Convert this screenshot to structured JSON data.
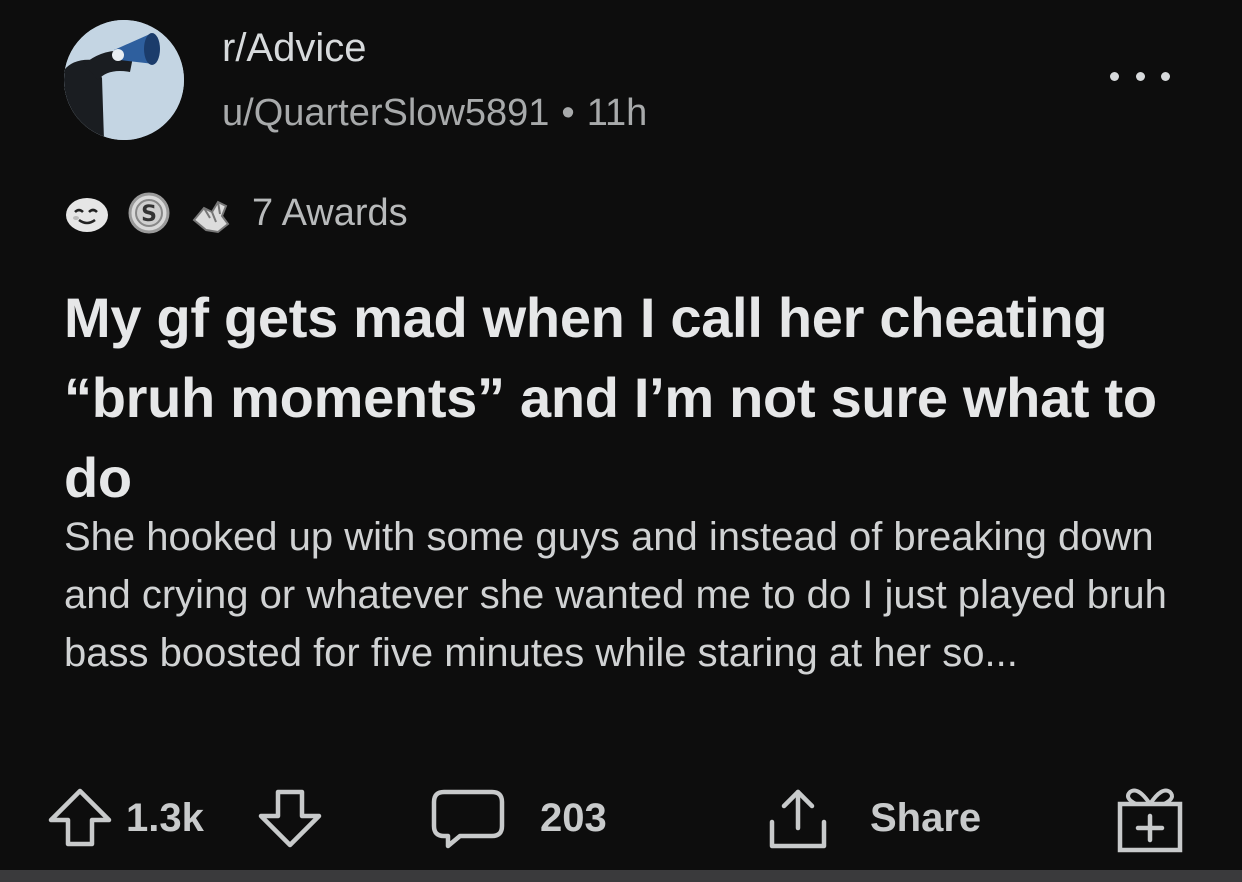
{
  "header": {
    "subreddit": "r/Advice",
    "username": "u/QuarterSlow5891",
    "separator": "•",
    "age": "11h",
    "more_icon": "more-horizontal-icon"
  },
  "awards": {
    "icons": [
      "wholesome-award-icon",
      "silver-coin-award-icon",
      "take-my-power-award-icon"
    ],
    "count_label": "7 Awards"
  },
  "post": {
    "title": "My gf gets mad when I call her cheating “bruh moments” and I’m not sure what to do",
    "body": "She hooked up with some guys and instead of breaking down and crying or whatever she wanted me to do I just played bruh bass boosted for five minutes while staring at her so..."
  },
  "actions": {
    "upvote_icon": "upvote-arrow-icon",
    "score": "1.3k",
    "downvote_icon": "downvote-arrow-icon",
    "comment_icon": "comment-bubble-icon",
    "comments": "203",
    "share_icon": "share-upload-icon",
    "share_label": "Share",
    "gift_icon": "gift-award-icon"
  },
  "colors": {
    "background": "#0d0d0d",
    "primary_text": "#e6e7e8",
    "secondary_text": "#a8aaab",
    "avatar_bg": "#c4d5e3"
  }
}
